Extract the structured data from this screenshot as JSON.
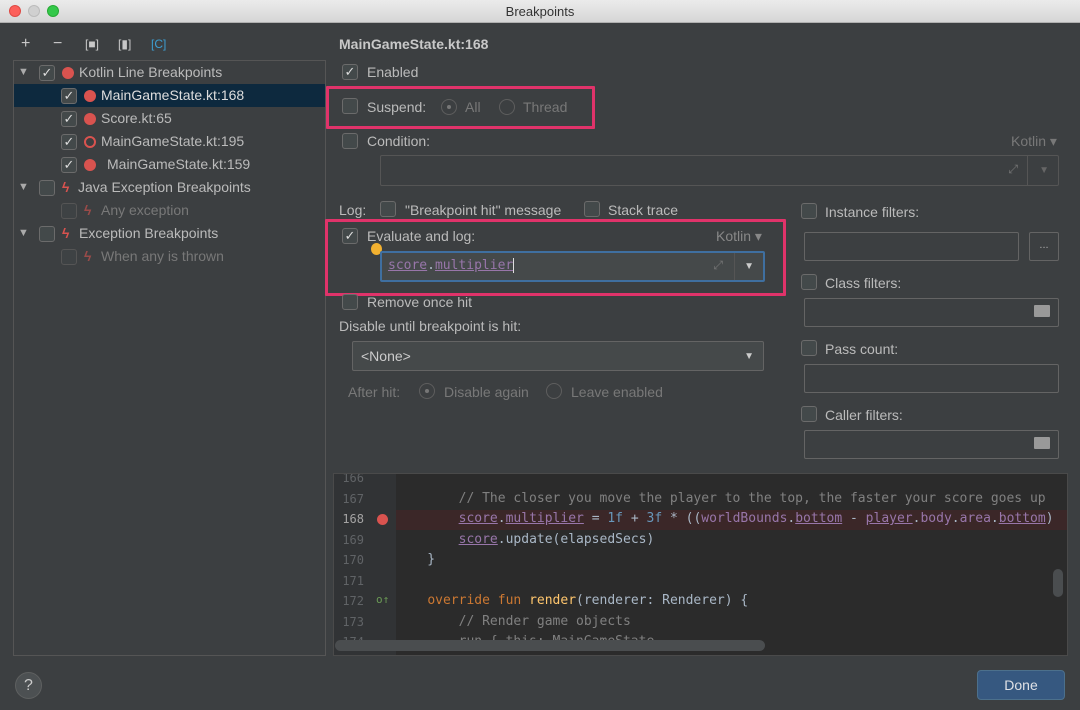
{
  "window": {
    "title": "Breakpoints"
  },
  "toolbar": {
    "add": "+",
    "remove": "−",
    "group_file": "[■]",
    "group_package": "[▮]",
    "group_class": "[C]"
  },
  "tree": {
    "groups": [
      {
        "label": "Kotlin Line Breakpoints",
        "checked": true,
        "items": [
          {
            "label": "MainGameState.kt:168",
            "checked": true,
            "selected": true
          },
          {
            "label": "Score.kt:65",
            "checked": true
          },
          {
            "label": "MainGameState.kt:195",
            "checked": true
          },
          {
            "label": "MainGameState.kt:159",
            "checked": true
          }
        ]
      },
      {
        "label": "Java Exception Breakpoints",
        "checked": false,
        "items": [
          {
            "label": "Any exception",
            "checked": false
          }
        ]
      },
      {
        "label": "Exception Breakpoints",
        "checked": false,
        "items": [
          {
            "label": "When any is thrown",
            "checked": false
          }
        ]
      }
    ]
  },
  "details": {
    "title": "MainGameState.kt:168",
    "enabled": "Enabled",
    "suspend": "Suspend:",
    "suspend_all": "All",
    "suspend_thread": "Thread",
    "condition": "Condition:",
    "condition_lang": "Kotlin",
    "log": "Log:",
    "log_message": "\"Breakpoint hit\" message",
    "stack_trace": "Stack trace",
    "evaluate": "Evaluate and log:",
    "evaluate_lang": "Kotlin",
    "evaluate_expr_obj": "score",
    "evaluate_expr_dot": ".",
    "evaluate_expr_prop": "multiplier",
    "remove_once": "Remove once hit",
    "disable_until": "Disable until breakpoint is hit:",
    "disable_until_value": "<None>",
    "after_hit": "After hit:",
    "disable_again": "Disable again",
    "leave_enabled": "Leave enabled",
    "instance_filters": "Instance filters:",
    "instance_more": "...",
    "class_filters": "Class filters:",
    "pass_count": "Pass count:",
    "caller_filters": "Caller filters:"
  },
  "highlight_color": "#e0336a",
  "editor": {
    "lines": [
      {
        "n": "166",
        "segs": []
      },
      {
        "n": "167",
        "segs": [
          {
            "t": "        // The closer you move the player to the top, the faster your score goes up",
            "c": "cm"
          }
        ]
      },
      {
        "n": "168",
        "bp": true,
        "segs": [
          {
            "t": "        "
          },
          {
            "t": "score",
            "c": "pr u"
          },
          {
            "t": "."
          },
          {
            "t": "multiplier",
            "c": "pr u"
          },
          {
            "t": " = "
          },
          {
            "t": "1f",
            "c": "num"
          },
          {
            "t": " + "
          },
          {
            "t": "3f",
            "c": "num"
          },
          {
            "t": " * (("
          },
          {
            "t": "worldBounds",
            "c": "pr"
          },
          {
            "t": "."
          },
          {
            "t": "bottom",
            "c": "pr u"
          },
          {
            "t": " - "
          },
          {
            "t": "player",
            "c": "pr u"
          },
          {
            "t": "."
          },
          {
            "t": "body",
            "c": "pr"
          },
          {
            "t": "."
          },
          {
            "t": "area",
            "c": "pr"
          },
          {
            "t": "."
          },
          {
            "t": "bottom",
            "c": "pr u"
          },
          {
            "t": ")"
          }
        ]
      },
      {
        "n": "169",
        "segs": [
          {
            "t": "        "
          },
          {
            "t": "score",
            "c": "pr u"
          },
          {
            "t": ".update(elapsedSecs)"
          }
        ]
      },
      {
        "n": "170",
        "segs": [
          {
            "t": "    }"
          }
        ]
      },
      {
        "n": "171",
        "segs": []
      },
      {
        "n": "172",
        "ov": true,
        "segs": [
          {
            "t": "    "
          },
          {
            "t": "override fun ",
            "c": "kw"
          },
          {
            "t": "render",
            "c": "fn"
          },
          {
            "t": "(renderer: Renderer) {"
          }
        ]
      },
      {
        "n": "173",
        "segs": [
          {
            "t": "        // Render game objects",
            "c": "cm"
          }
        ]
      },
      {
        "n": "174",
        "segs": [
          {
            "t": "        run { this: MainGameState",
            "c": "cm"
          }
        ]
      }
    ]
  },
  "footer": {
    "help": "?",
    "done": "Done"
  }
}
